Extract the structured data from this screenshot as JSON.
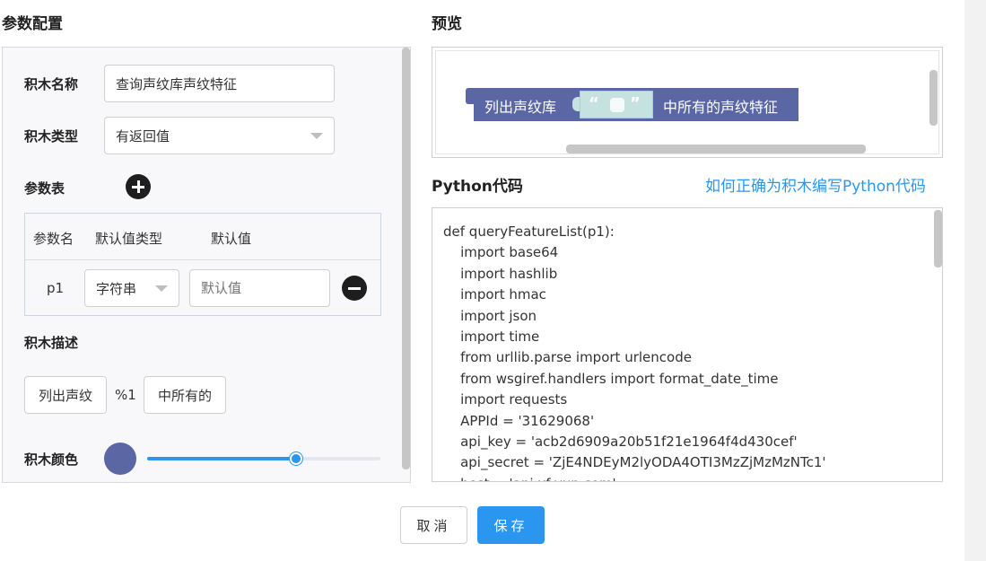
{
  "sections": {
    "params_title": "参数配置",
    "preview_title": "预览",
    "code_title": "Python代码",
    "code_help_link": "如何正确为积木编写Python代码"
  },
  "form": {
    "block_name_label": "积木名称",
    "block_name_value": "查询声纹库声纹特征",
    "block_type_label": "积木类型",
    "block_type_value": "有返回值",
    "param_table_label": "参数表",
    "param_headers": [
      "参数名",
      "默认值类型",
      "默认值"
    ],
    "param_rows": [
      {
        "name": "p1",
        "type": "字符串",
        "default_placeholder": "默认值"
      }
    ],
    "block_desc_label": "积木描述",
    "desc_parts": [
      "列出声纹",
      "%1",
      "中所有的"
    ],
    "block_color_label": "积木颜色",
    "block_color": "#5b67a5",
    "color_slider_level": 0.75
  },
  "preview": {
    "block_text_before": "列出声纹库",
    "quote_open": "“",
    "quote_close": "”",
    "block_text_after": "中所有的声纹特征"
  },
  "code_lines": [
    "def queryFeatureList(p1):",
    "    import base64",
    "    import hashlib",
    "    import hmac",
    "    import json",
    "    import time",
    "    from urllib.parse import urlencode",
    "    from wsgiref.handlers import format_date_time",
    "    import requests",
    "    APPId = '31629068'",
    "    api_key = 'acb2d6909a20b51f21e1964f4d430cef'",
    "    api_secret = 'ZjE4NDEyM2lyODA4OTI3MzZjMzMzNTc1'",
    "    host = 'api.xf-yun.com'"
  ],
  "buttons": {
    "cancel": "取消",
    "save": "保存"
  },
  "colors": {
    "accent": "#2a96f0",
    "block": "#5b67a5",
    "string_slot": "#c5e1e0"
  }
}
